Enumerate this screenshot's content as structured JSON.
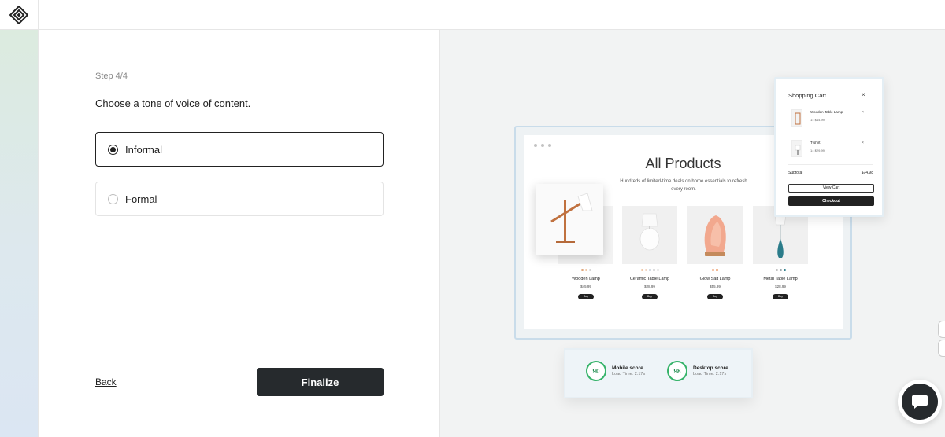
{
  "form": {
    "step": "Step 4/4",
    "question": "Choose a tone of voice of content.",
    "options": [
      {
        "label": "Informal",
        "selected": true
      },
      {
        "label": "Formal",
        "selected": false
      }
    ],
    "back_label": "Back",
    "finalize_label": "Finalize"
  },
  "preview": {
    "page_title": "All Products",
    "page_subtitle": "Hundreds of limited-time deals on home essentials to refresh every room.",
    "products": [
      {
        "name": "Wooden Lamp",
        "price": "$45.99",
        "buy": "Buy"
      },
      {
        "name": "Ceramic Table Lamp",
        "price": "$28.99",
        "buy": "Buy"
      },
      {
        "name": "Glow Salt Lamp",
        "price": "$55.99",
        "buy": "Buy"
      },
      {
        "name": "Metal Table Lamp",
        "price": "$28.99",
        "buy": "Buy"
      }
    ],
    "cart": {
      "title": "Shopping Cart",
      "close": "×",
      "items": [
        {
          "name": "Wooden Table Lamp",
          "price": "1× $44.99",
          "remove": "×"
        },
        {
          "name": "T-shirt",
          "price": "1× $29.99",
          "remove": "×"
        }
      ],
      "subtotal_label": "Subtotal",
      "subtotal_value": "$74.98",
      "view_cart": "View Cart",
      "checkout": "Checkout"
    },
    "scores": [
      {
        "value": "90",
        "label": "Mobile score",
        "load": "Load Time: 2.17s"
      },
      {
        "value": "98",
        "label": "Desktop score",
        "load": "Load Time: 2.17s"
      }
    ]
  },
  "icons": {
    "logo": "diamond-logo-icon",
    "chat": "chat-bubble-icon"
  },
  "colors": {
    "primary_button": "#262a2d",
    "score_ring": "#36b36a",
    "preview_bg": "#f2f3f3"
  }
}
